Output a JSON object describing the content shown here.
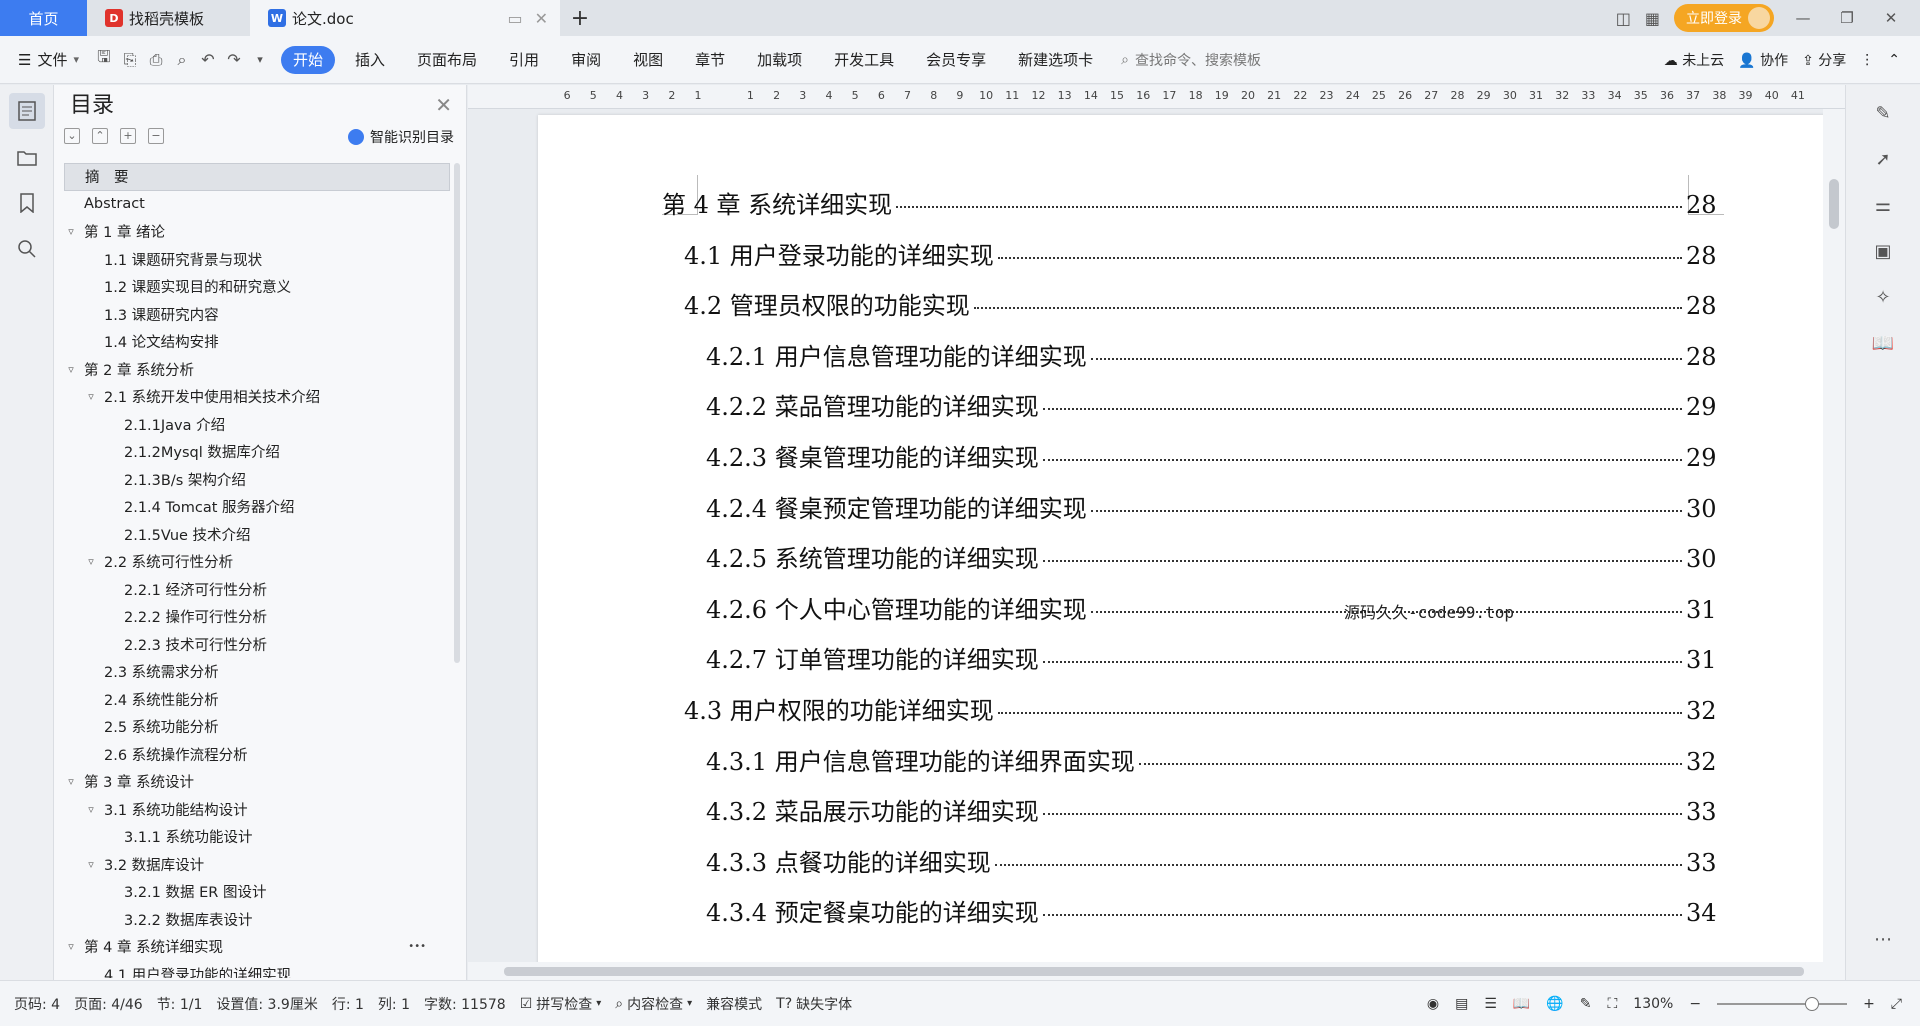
{
  "tabs": {
    "home": "首页",
    "template": "找稻壳模板",
    "document": "论文.doc"
  },
  "title_right": {
    "login": "立即登录"
  },
  "ribbon": {
    "file": "文件",
    "menus": [
      "开始",
      "插入",
      "页面布局",
      "引用",
      "审阅",
      "视图",
      "章节",
      "加载项",
      "开发工具",
      "会员专享",
      "新建选项卡"
    ],
    "search_placeholder": "查找命令、搜索模板",
    "cloud": "未上云",
    "collab": "协作",
    "share": "分享"
  },
  "toc_panel": {
    "title": "目录",
    "smart": "智能识别目录",
    "items": [
      {
        "label": "摘　要",
        "level": 0,
        "arrow": false,
        "selected": true
      },
      {
        "label": "Abstract",
        "level": 0,
        "arrow": false
      },
      {
        "label": "第 1 章  绪论",
        "level": 0,
        "arrow": true
      },
      {
        "label": "1.1 课题研究背景与现状",
        "level": 1,
        "arrow": false
      },
      {
        "label": "1.2 课题实现目的和研究意义",
        "level": 1,
        "arrow": false
      },
      {
        "label": "1.3 课题研究内容",
        "level": 1,
        "arrow": false
      },
      {
        "label": "1.4 论文结构安排",
        "level": 1,
        "arrow": false
      },
      {
        "label": "第 2 章  系统分析",
        "level": 0,
        "arrow": true
      },
      {
        "label": "2.1 系统开发中使用相关技术介绍",
        "level": 1,
        "arrow": true
      },
      {
        "label": "2.1.1Java 介绍",
        "level": 2,
        "arrow": false
      },
      {
        "label": "2.1.2Mysql 数据库介绍",
        "level": 2,
        "arrow": false
      },
      {
        "label": "2.1.3B/s 架构介绍",
        "level": 2,
        "arrow": false
      },
      {
        "label": "2.1.4 Tomcat 服务器介绍",
        "level": 2,
        "arrow": false
      },
      {
        "label": "2.1.5Vue 技术介绍",
        "level": 2,
        "arrow": false
      },
      {
        "label": "2.2 系统可行性分析",
        "level": 1,
        "arrow": true
      },
      {
        "label": "2.2.1 经济可行性分析",
        "level": 2,
        "arrow": false
      },
      {
        "label": "2.2.2 操作可行性分析",
        "level": 2,
        "arrow": false
      },
      {
        "label": "2.2.3 技术可行性分析",
        "level": 2,
        "arrow": false
      },
      {
        "label": "2.3 系统需求分析",
        "level": 1,
        "arrow": false
      },
      {
        "label": "2.4 系统性能分析",
        "level": 1,
        "arrow": false
      },
      {
        "label": "2.5 系统功能分析",
        "level": 1,
        "arrow": false
      },
      {
        "label": "2.6 系统操作流程分析",
        "level": 1,
        "arrow": false
      },
      {
        "label": "第 3 章  系统设计",
        "level": 0,
        "arrow": true
      },
      {
        "label": "3.1 系统功能结构设计",
        "level": 1,
        "arrow": true
      },
      {
        "label": "3.1.1 系统功能设计",
        "level": 2,
        "arrow": false
      },
      {
        "label": "3.2 数据库设计",
        "level": 1,
        "arrow": true
      },
      {
        "label": "3.2.1 数据 ER 图设计",
        "level": 2,
        "arrow": false
      },
      {
        "label": "3.2.2 数据库表设计",
        "level": 2,
        "arrow": false
      },
      {
        "label": "第 4 章  系统详细实现",
        "level": 0,
        "arrow": true,
        "more": true
      },
      {
        "label": "4.1 用户登录功能的详细实现",
        "level": 1,
        "arrow": false
      }
    ]
  },
  "ruler": {
    "numbers": [
      "6",
      "5",
      "4",
      "3",
      "2",
      "1",
      "",
      "1",
      "2",
      "3",
      "4",
      "5",
      "6",
      "7",
      "8",
      "9",
      "10",
      "11",
      "12",
      "13",
      "14",
      "15",
      "16",
      "17",
      "18",
      "19",
      "20",
      "21",
      "22",
      "23",
      "24",
      "25",
      "26",
      "27",
      "28",
      "29",
      "30",
      "31",
      "32",
      "33",
      "34",
      "35",
      "36",
      "37",
      "38",
      "39",
      "40",
      "41"
    ]
  },
  "document": {
    "lines": [
      {
        "text": "第 4 章  系统详细实现",
        "page": "28",
        "level": 0
      },
      {
        "text": "4.1 用户登录功能的详细实现",
        "page": "28",
        "level": 1
      },
      {
        "text": "4.2 管理员权限的功能实现",
        "page": "28",
        "level": 1
      },
      {
        "text": "4.2.1 用户信息管理功能的详细实现",
        "page": "28",
        "level": 2
      },
      {
        "text": "4.2.2 菜品管理功能的详细实现",
        "page": "29",
        "level": 2
      },
      {
        "text": "4.2.3 餐桌管理功能的详细实现",
        "page": "29",
        "level": 2
      },
      {
        "text": "4.2.4 餐桌预定管理功能的详细实现",
        "page": "30",
        "level": 2
      },
      {
        "text": "4.2.5 系统管理功能的详细实现",
        "page": "30",
        "level": 2
      },
      {
        "text": "4.2.6 个人中心管理功能的详细实现",
        "page": "31",
        "level": 2
      },
      {
        "text": "4.2.7 订单管理功能的详细实现",
        "page": "31",
        "level": 2
      },
      {
        "text": "4.3 用户权限的功能详细实现",
        "page": "32",
        "level": 1
      },
      {
        "text": "4.3.1 用户信息管理功能的详细界面实现",
        "page": "32",
        "level": 2
      },
      {
        "text": "4.3.2 菜品展示功能的详细实现",
        "page": "33",
        "level": 2
      },
      {
        "text": "4.3.3 点餐功能的详细实现",
        "page": "33",
        "level": 2
      },
      {
        "text": "4.3.4 预定餐桌功能的详细实现",
        "page": "34",
        "level": 2
      }
    ],
    "watermark": "源码久久-code99.top"
  },
  "status": {
    "page_code": "页码: 4",
    "page": "页面: 4/46",
    "section": "节: 1/1",
    "setting": "设置值: 3.9厘米",
    "row": "行: 1",
    "col": "列: 1",
    "words": "字数: 11578",
    "spell": "拼写检查",
    "content_check": "内容检查",
    "compat": "兼容模式",
    "missing_font": "缺失字体",
    "zoom": "130%"
  },
  "colors": {
    "accent": "#3d7cf0",
    "login": "#f5a623"
  }
}
